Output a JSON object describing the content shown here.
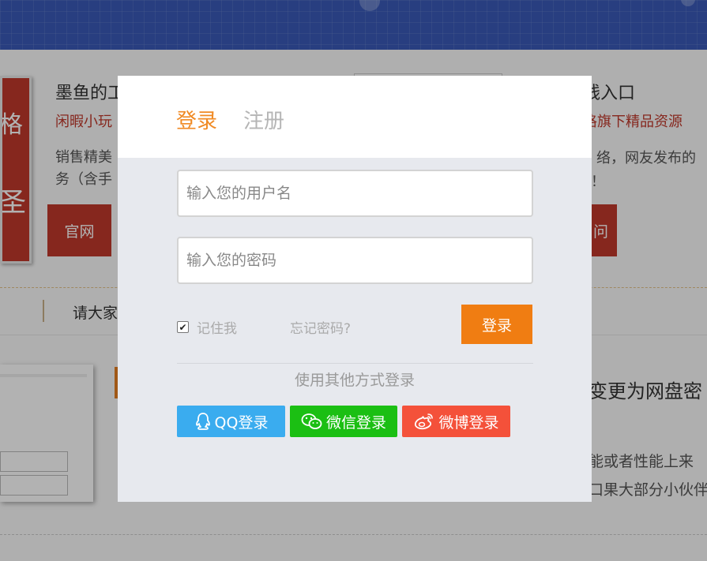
{
  "background": {
    "logo_char_top": "格",
    "logo_char_bottom": "圣",
    "site_title": "墨鱼的工",
    "site_subtitle": "闲暇小玩",
    "site_desc_line1": "销售精美",
    "site_desc_line2": "务（含手",
    "site_button": "官网",
    "right_title": "线入口",
    "right_subtitle": "格旗下精品资源",
    "right_desc_line1": "络，网友发布的",
    "right_desc_line2": "！",
    "right_button": "问",
    "notice_text": "请大家",
    "article_title": "变更为网盘密",
    "article_line1": "能或者性能上来",
    "article_line2": "口果大部分小伙伴"
  },
  "modal": {
    "tab_login": "登录",
    "tab_register": "注册",
    "username_placeholder": "输入您的用户名",
    "password_placeholder": "输入您的密码",
    "remember_label": "记住我",
    "remember_checked": true,
    "forgot_label": "忘记密码?",
    "login_button": "登录",
    "other_methods_label": "使用其他方式登录",
    "social": {
      "qq": {
        "label": "QQ登录",
        "icon": "qq-icon",
        "color": "#3aacef"
      },
      "wechat": {
        "label": "微信登录",
        "icon": "wechat-icon",
        "color": "#1bbf13"
      },
      "weibo": {
        "label": "微博登录",
        "icon": "weibo-icon",
        "color": "#f4513a"
      }
    }
  },
  "colors": {
    "accent": "#f07d12",
    "tab_active": "#f08a24",
    "header_blue": "#3a5ab8",
    "brand_red": "#c0392b"
  }
}
